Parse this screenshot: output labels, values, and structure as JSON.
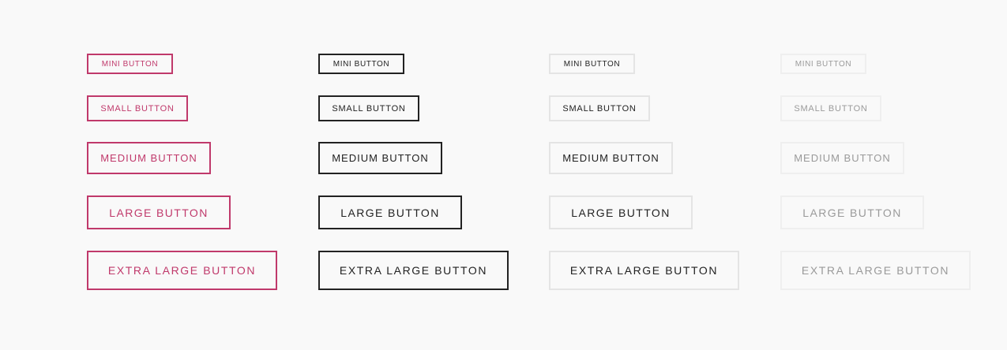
{
  "buttons": {
    "primary": {
      "mini": "Mini Button",
      "small": "Small Button",
      "medium": "Medium Button",
      "large": "Large Button",
      "xl": "Extra Large Button"
    },
    "dark": {
      "mini": "Mini Button",
      "small": "Small Button",
      "medium": "Medium Button",
      "large": "Large Button",
      "xl": "Extra Large Button"
    },
    "light": {
      "mini": "Mini Button",
      "small": "Small Button",
      "medium": "Medium Button",
      "large": "Large Button",
      "xl": "Extra Large Button"
    },
    "disabled": {
      "mini": "Mini Button",
      "small": "Small Button",
      "medium": "Medium Button",
      "large": "Large Button",
      "xl": "Extra Large Button"
    }
  },
  "colors": {
    "background": "#f9f9f9",
    "primary": "#c0396b",
    "dark": "#222222",
    "light_border": "#e4e4e4",
    "disabled_border": "#efefef",
    "disabled_text": "#9a9a9a"
  }
}
